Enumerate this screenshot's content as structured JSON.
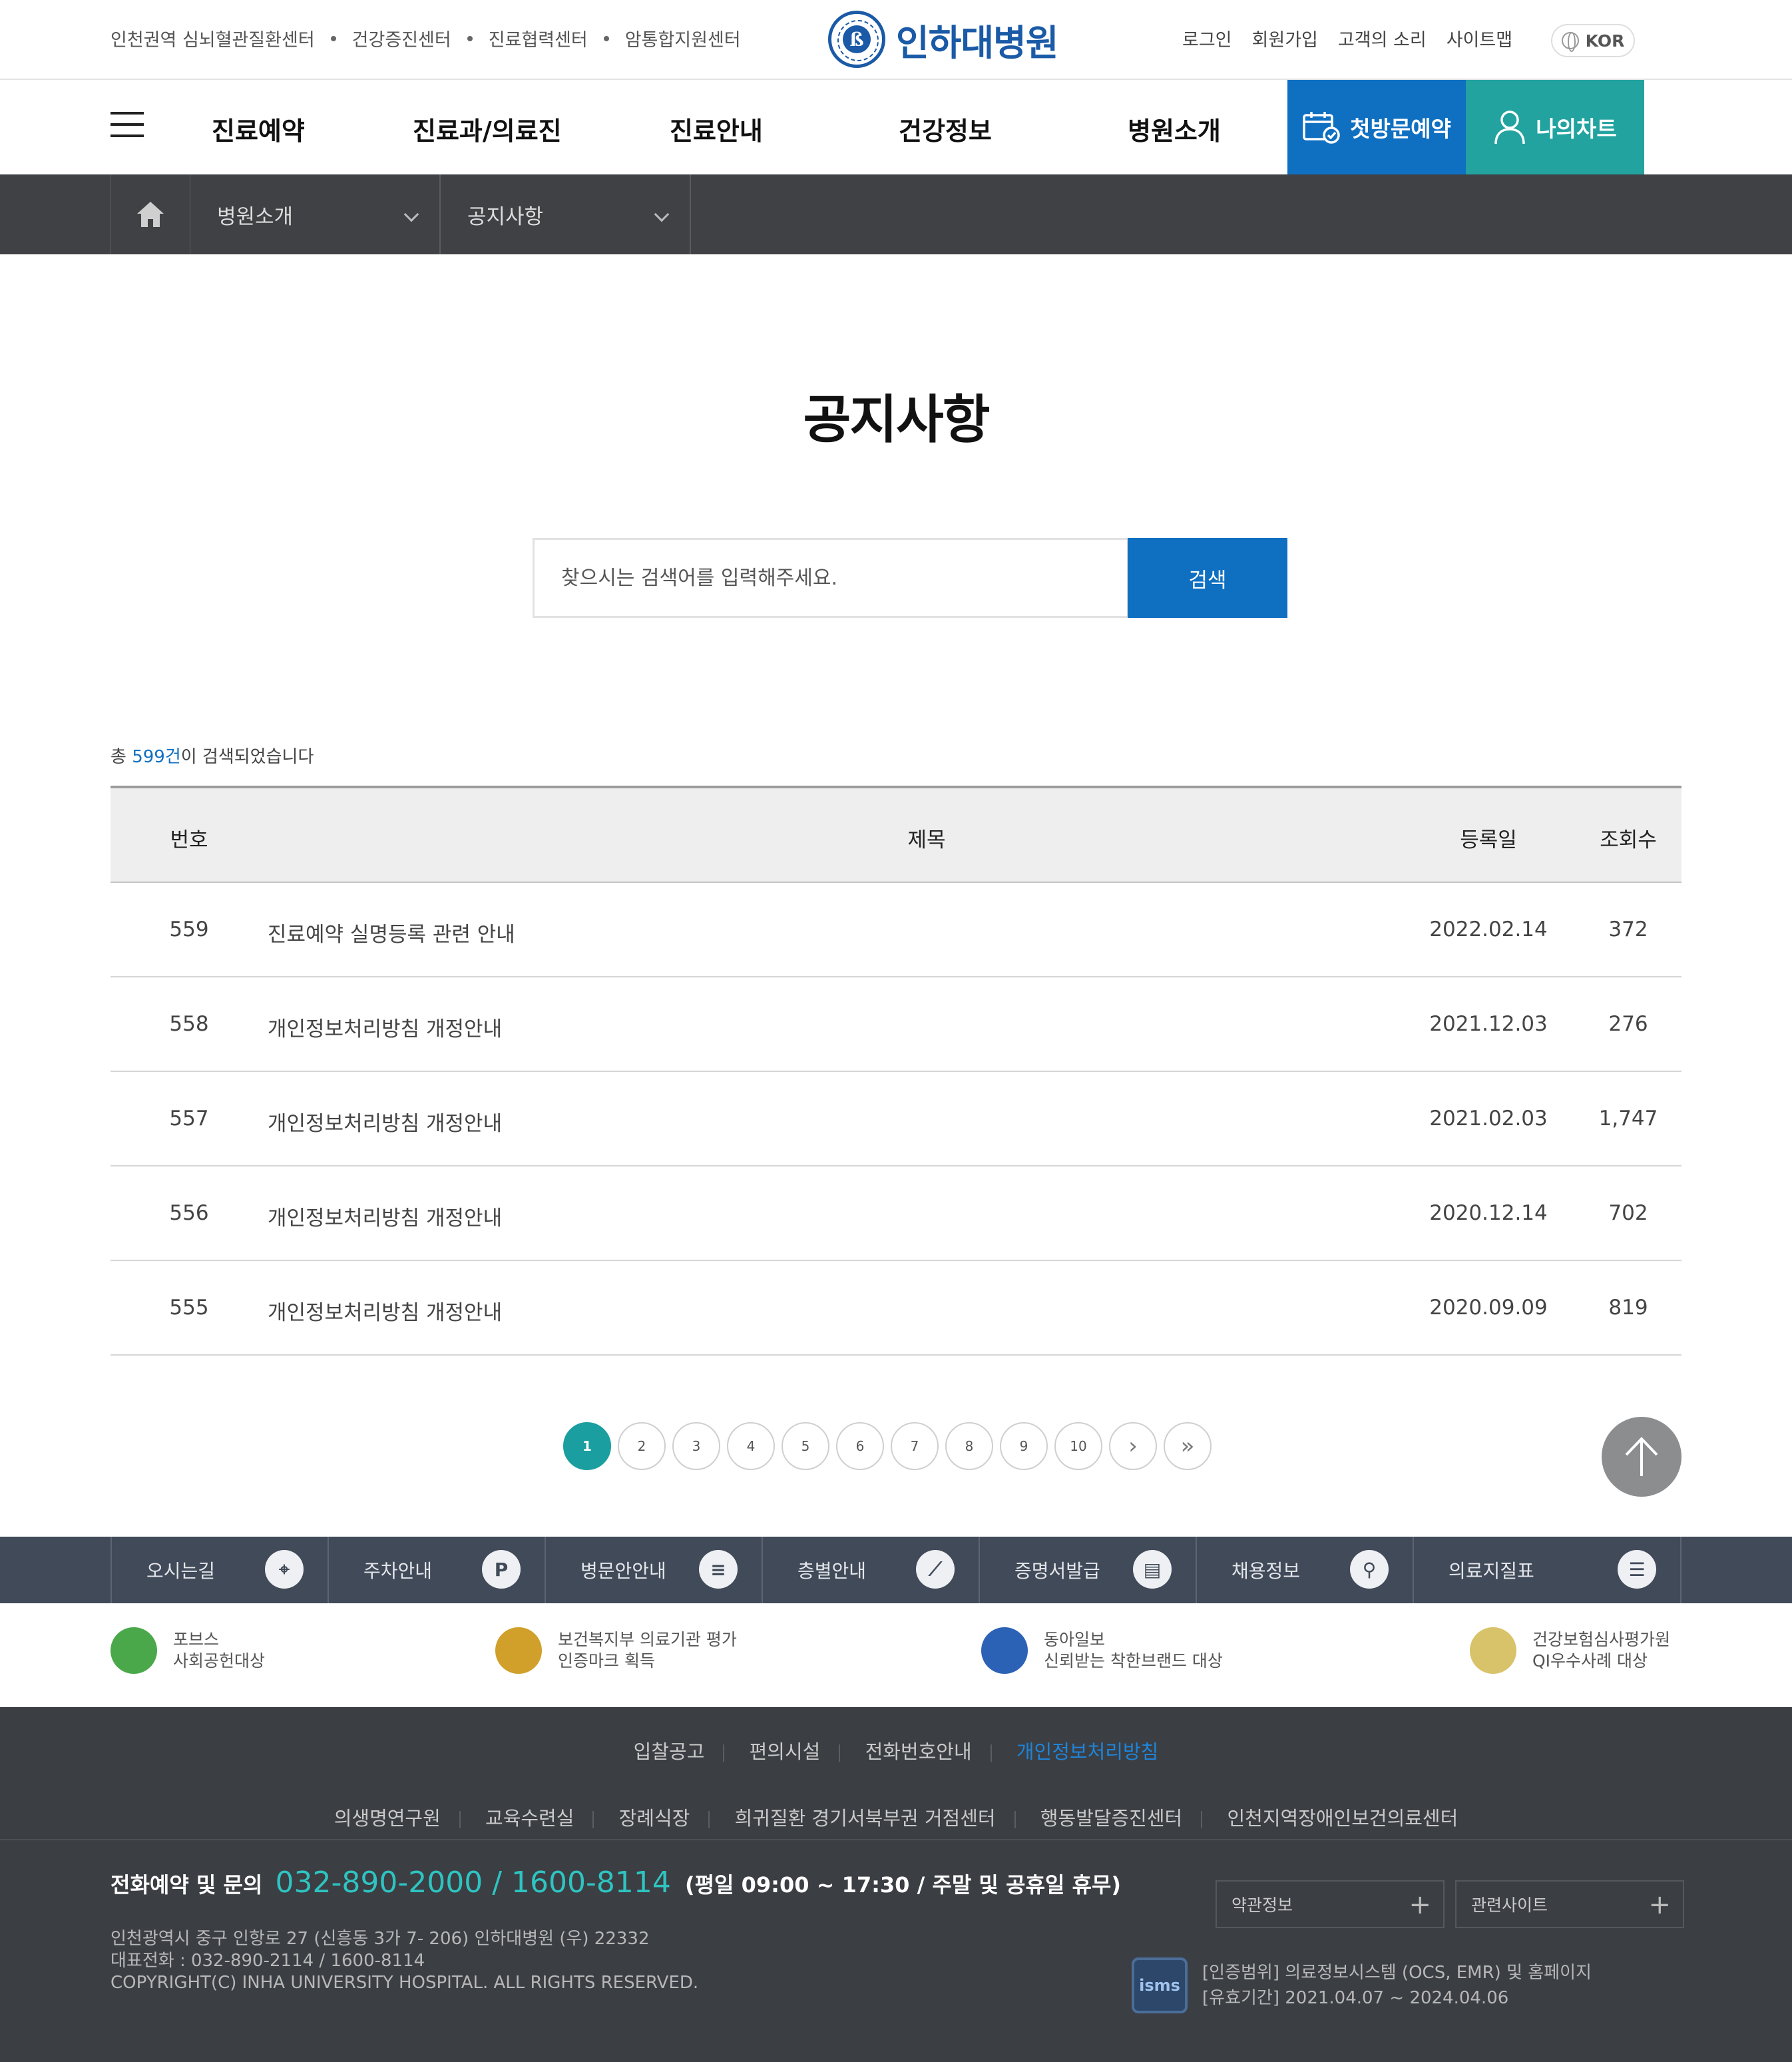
{
  "topbar": {
    "center_links": [
      "인천권역 심뇌혈관질환센터",
      "건강증진센터",
      "진료협력센터",
      "암통합지원센터"
    ],
    "logo_text": "인하대병원",
    "util_links": [
      "로그인",
      "회원가입",
      "고객의 소리",
      "사이트맵"
    ],
    "lang": "KOR"
  },
  "nav": {
    "items": [
      "진료예약",
      "진료과/의료진",
      "진료안내",
      "건강정보",
      "병원소개"
    ],
    "first_visit": "첫방문예약",
    "my_chart": "나의차트",
    "first_visit_color": "#0f6fc1",
    "my_chart_color": "#22a3a0"
  },
  "breadcrumb": {
    "level1": "병원소개",
    "level2": "공지사항"
  },
  "page": {
    "title": "공지사항"
  },
  "search": {
    "placeholder": "찾으시는 검색어를 입력해주세요.",
    "button": "검색"
  },
  "results": {
    "prefix": "총 ",
    "count": "599건",
    "suffix": "이 검색되었습니다"
  },
  "table": {
    "headers": {
      "no": "번호",
      "title": "제목",
      "date": "등록일",
      "views": "조회수"
    },
    "rows": [
      {
        "no": "559",
        "title": "진료예약 실명등록 관련 안내",
        "date": "2022.02.14",
        "views": "372"
      },
      {
        "no": "558",
        "title": "개인정보처리방침 개정안내",
        "date": "2021.12.03",
        "views": "276"
      },
      {
        "no": "557",
        "title": "개인정보처리방침 개정안내",
        "date": "2021.02.03",
        "views": "1,747"
      },
      {
        "no": "556",
        "title": "개인정보처리방침 개정안내",
        "date": "2020.12.14",
        "views": "702"
      },
      {
        "no": "555",
        "title": "개인정보처리방침 개정안내",
        "date": "2020.09.09",
        "views": "819"
      }
    ]
  },
  "pagination": {
    "pages": [
      "1",
      "2",
      "3",
      "4",
      "5",
      "6",
      "7",
      "8",
      "9",
      "10"
    ],
    "current": "1",
    "next": "›",
    "last": "»"
  },
  "quickmenu": [
    {
      "label": "오시는길",
      "icon": "location-pin-icon",
      "glyph": "⌖"
    },
    {
      "label": "주차안내",
      "icon": "parking-icon",
      "glyph": "P"
    },
    {
      "label": "병문안안내",
      "icon": "bed-icon",
      "glyph": "≡"
    },
    {
      "label": "층별안내",
      "icon": "stairs-icon",
      "glyph": "⟋"
    },
    {
      "label": "증명서발급",
      "icon": "printer-icon",
      "glyph": "▤"
    },
    {
      "label": "채용정보",
      "icon": "person-search-icon",
      "glyph": "⚲"
    },
    {
      "label": "의료지질표",
      "icon": "clipboard-icon",
      "glyph": "☰"
    }
  ],
  "awards": [
    {
      "line1": "포브스",
      "line2": "사회공헌대상",
      "icon": "forbes-award-icon",
      "color": "#4aa84a"
    },
    {
      "line1": "보건복지부 의료기관 평가",
      "line2": "인증마크 획득",
      "icon": "certification-mark-icon",
      "color": "#d1a02a"
    },
    {
      "line1": "동아일보",
      "line2": "신뢰받는 착한브랜드 대상",
      "icon": "good-brand-icon",
      "color": "#2b62b5"
    },
    {
      "line1": "건강보험심사평가원",
      "line2": "QI우수사례 대상",
      "icon": "qi-award-icon",
      "color": "#d8c36a"
    }
  ],
  "footer_links_row1": [
    "입찰공고",
    "편의시설",
    "전화번호안내",
    "개인정보처리방침"
  ],
  "footer_links_row2": [
    "의생명연구원",
    "교육수련실",
    "장례식장",
    "희귀질환 경기서북부권 거점센터",
    "행동발달증진센터",
    "인천지역장애인보건의료센터"
  ],
  "footer": {
    "contact_label": "전화예약 및 문의",
    "phone": "032-890-2000 / 1600-8114",
    "hours": "(평일 09:00 ~ 17:30 / 주말 및 공휴일 휴무)",
    "address": "인천광역시 중구 인항로 27 (신흥동 3가 7- 206) 인하대병원 (우) 22332",
    "main_phone": "대표전화 : 032-890-2114 / 1600-8114",
    "copyright": "COPYRIGHT(C) INHA UNIVERSITY HOSPITAL. ALL RIGHTS RESERVED.",
    "terms_label": "약관정보",
    "related_label": "관련사이트",
    "isms_badge": "isms",
    "isms_scope": "[인증범위] 의료정보시스템 (OCS, EMR) 및 홈페이지",
    "isms_period": "[유효기간] 2021.04.07 ~ 2024.04.06"
  }
}
